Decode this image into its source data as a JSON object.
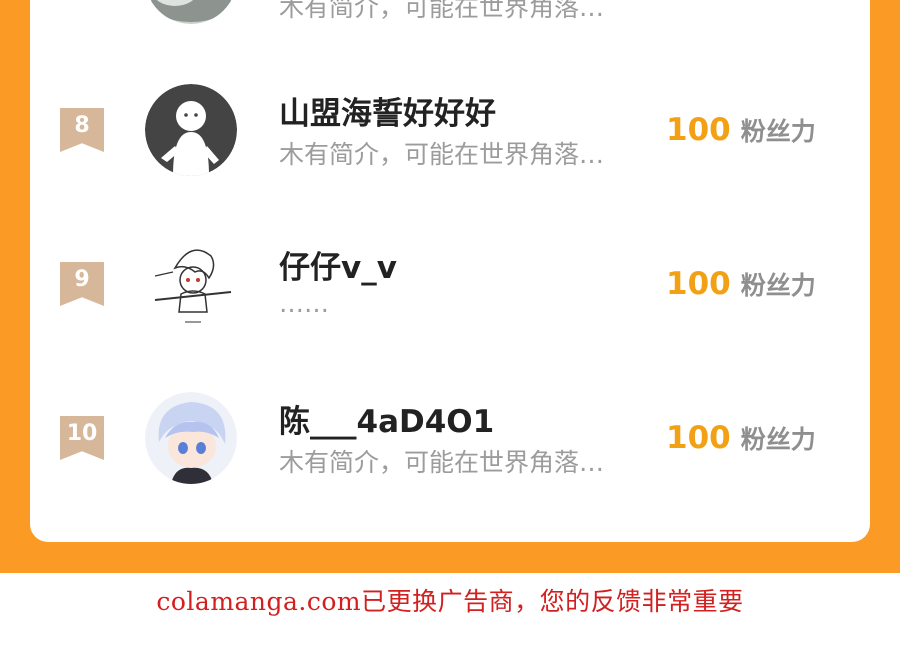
{
  "top_partial": {
    "bio": "木有简介，可能在世界角落…"
  },
  "rows": [
    {
      "rank": "8",
      "name": "山盟海誓好好好",
      "bio": "木有简介，可能在世界角落…",
      "fans_count": "100",
      "fans_unit": "粉丝力"
    },
    {
      "rank": "9",
      "name": "仔仔v_v",
      "bio": "……",
      "fans_count": "100",
      "fans_unit": "粉丝力"
    },
    {
      "rank": "10",
      "name": "陈___4aD4O1",
      "bio": "木有简介，可能在世界角落…",
      "fans_count": "100",
      "fans_unit": "粉丝力"
    }
  ],
  "footer": {
    "notice": "colamanga.com已更换广告商，您的反馈非常重要"
  },
  "colors": {
    "accent_orange": "#fb9a24",
    "fans_count": "#f2a115",
    "rank_badge": "#d6b79a",
    "footer_text": "#d22020"
  }
}
